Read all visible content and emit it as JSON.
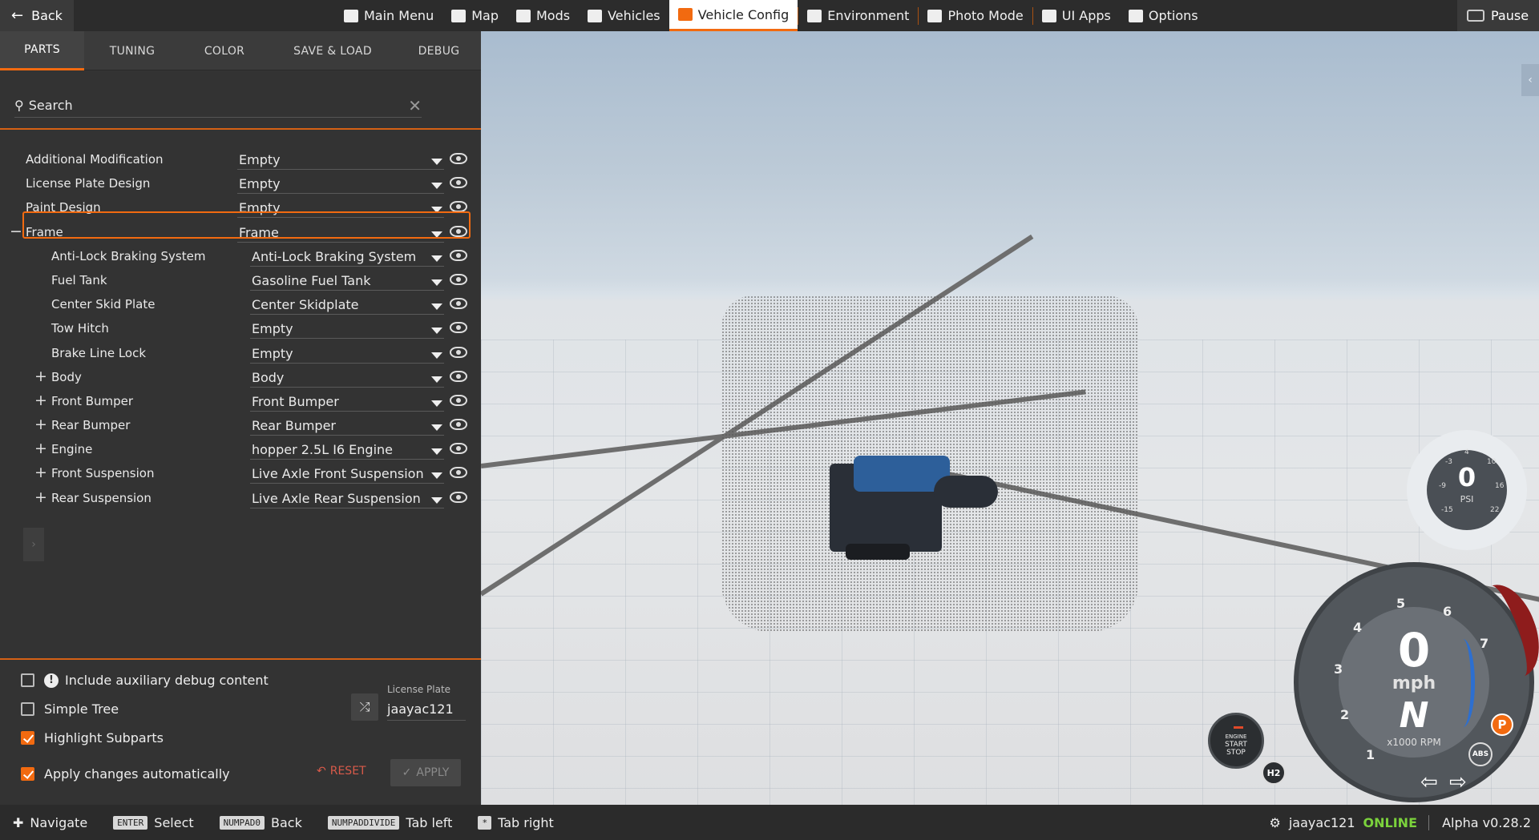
{
  "topbar": {
    "back_label": "Back",
    "nav": [
      {
        "label": "Main Menu",
        "icon": "menu-grid-icon"
      },
      {
        "label": "Map",
        "icon": "map-icon"
      },
      {
        "label": "Mods",
        "icon": "puzzle-icon"
      },
      {
        "label": "Vehicles",
        "icon": "car-icon"
      },
      {
        "label": "Vehicle Config",
        "icon": "engine-icon",
        "active": true
      },
      {
        "label": "Environment",
        "icon": "weather-icon"
      },
      {
        "label": "Photo Mode",
        "icon": "camera-icon"
      },
      {
        "label": "UI Apps",
        "icon": "apps-icon"
      },
      {
        "label": "Options",
        "icon": "sliders-icon"
      }
    ],
    "pause_label": "Pause",
    "accent_color": "#f26a10"
  },
  "panel": {
    "tabs": [
      "PARTS",
      "TUNING",
      "COLOR",
      "SAVE & LOAD",
      "DEBUG"
    ],
    "active_tab": "PARTS",
    "search_placeholder": "Search",
    "parts": [
      {
        "name": "Additional Modification",
        "value": "Empty",
        "level": 0
      },
      {
        "name": "License Plate Design",
        "value": "Empty",
        "level": 0
      },
      {
        "name": "Paint Design",
        "value": "Empty",
        "level": 0
      },
      {
        "name": "Frame",
        "value": "Frame",
        "level": 0,
        "expander": "−",
        "highlighted": true
      },
      {
        "name": "Anti-Lock Braking System",
        "value": "Anti-Lock Braking System",
        "level": 1
      },
      {
        "name": "Fuel Tank",
        "value": "Gasoline Fuel Tank",
        "level": 1
      },
      {
        "name": "Center Skid Plate",
        "value": "Center Skidplate",
        "level": 1
      },
      {
        "name": "Tow Hitch",
        "value": "Empty",
        "level": 1
      },
      {
        "name": "Brake Line Lock",
        "value": "Empty",
        "level": 1
      },
      {
        "name": "Body",
        "value": "Body",
        "level": 1,
        "expander": "+"
      },
      {
        "name": "Front Bumper",
        "value": "Front Bumper",
        "level": 1,
        "expander": "+"
      },
      {
        "name": "Rear Bumper",
        "value": "Rear Bumper",
        "level": 1,
        "expander": "+"
      },
      {
        "name": "Engine",
        "value": "hopper 2.5L I6 Engine",
        "level": 1,
        "expander": "+"
      },
      {
        "name": "Front Suspension",
        "value": "Live Axle Front Suspension",
        "level": 1,
        "expander": "+"
      },
      {
        "name": "Rear Suspension",
        "value": "Live Axle Rear Suspension",
        "level": 1,
        "expander": "+"
      }
    ],
    "options": {
      "aux_debug": {
        "label": "Include auxiliary debug content",
        "checked": false
      },
      "simple_tree": {
        "label": "Simple Tree",
        "checked": false
      },
      "highlight_subparts": {
        "label": "Highlight Subparts",
        "checked": true
      },
      "apply_auto": {
        "label": "Apply changes automatically",
        "checked": true
      }
    },
    "license_plate": {
      "label": "License Plate",
      "value": "jaayac121"
    },
    "reset_label": "RESET",
    "apply_label": "APPLY"
  },
  "hud": {
    "boost": {
      "value": "0",
      "unit": "PSI",
      "ticks": [
        "-3",
        "4",
        "10",
        "-9",
        "16",
        "-15",
        "22"
      ]
    },
    "speed": {
      "value": "0",
      "unit": "mph",
      "gear": "N",
      "rpm_label": "x1000 RPM",
      "numbers": [
        "1",
        "2",
        "3",
        "4",
        "5",
        "6",
        "7"
      ]
    },
    "park_label": "P",
    "abs_label": "ABS",
    "start_stop": [
      "ENGINE",
      "START",
      "STOP"
    ],
    "h2_label": "H2"
  },
  "bottombar": {
    "hints": [
      {
        "key": "",
        "label": "Navigate",
        "icon": "dpad-icon"
      },
      {
        "key": "ENTER",
        "label": "Select"
      },
      {
        "key": "NUMPAD0",
        "label": "Back"
      },
      {
        "key": "NUMPADDIVIDE",
        "label": "Tab left"
      },
      {
        "key": "*",
        "label": "Tab right"
      }
    ],
    "username": "jaayac121",
    "status": "ONLINE",
    "version": "Alpha v0.28.2"
  }
}
